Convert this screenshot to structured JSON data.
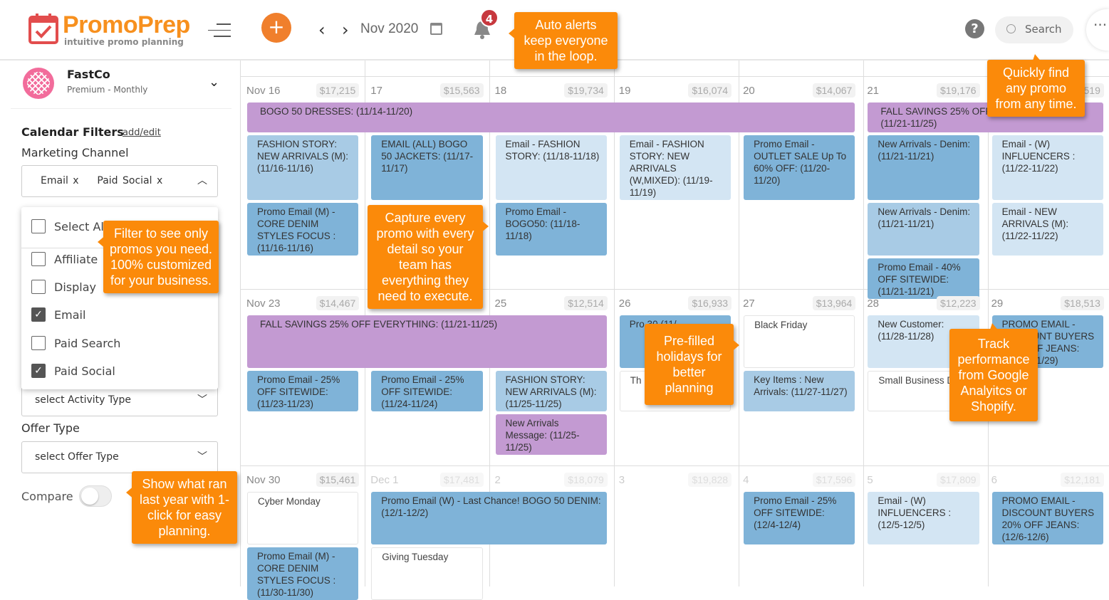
{
  "header": {
    "logo_text": "PromoPrep",
    "logo_tagline": "intuitive promo planning",
    "add_label": "+",
    "month": "Nov 2020",
    "notifications": "4",
    "help": "?",
    "search_label": "Search",
    "more": "···"
  },
  "account": {
    "name": "FastCo",
    "plan": "Premium - Monthly"
  },
  "filters": {
    "title": "Calendar Filters",
    "edit_link": "add/edit",
    "channel_label": "Marketing Channel",
    "channel_value": "Email x    Paid Social x",
    "options": [
      {
        "label": "Select All",
        "checked": false
      },
      {
        "label": "Affiliate",
        "checked": false
      },
      {
        "label": "Display",
        "checked": false
      },
      {
        "label": "Email",
        "checked": true
      },
      {
        "label": "Paid Search",
        "checked": false
      },
      {
        "label": "Paid Social",
        "checked": true
      }
    ],
    "activity_placeholder": "select Activity Type",
    "offer_label": "Offer Type",
    "offer_placeholder": "select Offer Type",
    "compare_label": "Compare",
    "compare_on": false
  },
  "colors": {
    "accent": "#f7901e",
    "dark": "#7fb3d8",
    "light": "#a8cbe5",
    "pale": "#d3e5f3",
    "purple": "#c39ad2",
    "tooltip": "#fb8a0a"
  },
  "weeks": [
    {
      "days": [
        {
          "label": "Nov 16",
          "amount": "$17,215"
        },
        {
          "label": "17",
          "amount": "$15,563"
        },
        {
          "label": "18",
          "amount": "$19,734"
        },
        {
          "label": "19",
          "amount": "$16,074"
        },
        {
          "label": "20",
          "amount": "$14,067"
        },
        {
          "label": "21",
          "amount": "$19,176"
        },
        {
          "label": "22",
          "amount": "$18,519"
        }
      ],
      "rows": [
        [
          {
            "col": 1,
            "span": 5,
            "kind": "purple",
            "text": "BOGO 50 DRESSES: (11/14-11/20)"
          },
          {
            "col": 6,
            "span": 2,
            "kind": "purple",
            "text": "FALL SAVINGS 25% OFF EVERYTHING: (11/21-11/25)"
          }
        ],
        [
          {
            "col": 1,
            "kind": "light",
            "text": "FASHION STORY: NEW ARRIVALS (M): (11/16-11/16)"
          },
          {
            "col": 2,
            "kind": "dark",
            "text": "EMAIL (ALL) BOGO 50 JACKETS: (11/17-11/17)"
          },
          {
            "col": 3,
            "kind": "pale",
            "text": "Email - FASHION STORY: (11/18-11/18)"
          },
          {
            "col": 4,
            "kind": "pale",
            "text": "Email - FASHION STORY: NEW ARRIVALS (W,MIXED): (11/19-11/19)"
          },
          {
            "col": 5,
            "kind": "dark",
            "text": "Promo Email - OUTLET SALE Up To 60% OFF: (11/20-11/20)"
          },
          {
            "col": 6,
            "kind": "dark",
            "text": "New Arrivals - Denim: (11/21-11/21)"
          },
          {
            "col": 7,
            "kind": "pale",
            "text": "Email - (W) INFLUENCERS : (11/22-11/22)"
          }
        ],
        [
          {
            "col": 1,
            "kind": "dark",
            "text": "Promo Email (M) - CORE DENIM STYLES FOCUS : (11/16-11/16)"
          },
          {
            "col": 3,
            "kind": "dark",
            "text": "Promo Email - BOGO50: (11/18-11/18)"
          },
          {
            "col": 6,
            "kind": "light",
            "text": "New Arrivals - Denim: (11/21-11/21)"
          },
          {
            "col": 7,
            "kind": "pale",
            "text": "Email - NEW ARRIVALS (M): (11/22-11/22)"
          }
        ],
        [
          {
            "col": 6,
            "kind": "dark",
            "text": "Promo Email - 40% OFF SITEWIDE: (11/21-11/21)"
          }
        ]
      ]
    },
    {
      "days": [
        {
          "label": "Nov 23",
          "amount": "$14,467"
        },
        {
          "label": "",
          "amount": ""
        },
        {
          "label": "25",
          "amount": "$12,514"
        },
        {
          "label": "26",
          "amount": "$16,933"
        },
        {
          "label": "27",
          "amount": "$13,964"
        },
        {
          "label": "28",
          "amount": "$12,223"
        },
        {
          "label": "29",
          "amount": "$18,513"
        }
      ],
      "rows": [
        [
          {
            "col": 1,
            "span": 3,
            "kind": "purple",
            "text": "FALL SAVINGS 25% OFF EVERYTHING: (11/21-11/25)"
          },
          {
            "col": 4,
            "kind": "dark",
            "text": "Pro 30 (11/"
          },
          {
            "col": 5,
            "kind": "holiday",
            "text": "Black Friday"
          },
          {
            "col": 6,
            "kind": "pale",
            "text": "New Customer: (11/28-11/28)"
          },
          {
            "col": 7,
            "kind": "dark",
            "text": "PROMO EMAIL - DISCOUNT BUYERS 20% OFF JEANS: (11/29-11/29)"
          }
        ],
        [
          {
            "col": 1,
            "kind": "dark",
            "text": "Promo Email - 25% OFF SITEWIDE: (11/23-11/23)"
          },
          {
            "col": 2,
            "kind": "dark",
            "text": "Promo Email - 25% OFF SITEWIDE: (11/24-11/24)"
          },
          {
            "col": 3,
            "kind": "light",
            "text": "FASHION STORY: NEW ARRIVALS (M): (11/25-11/25)"
          },
          {
            "col": 4,
            "kind": "holiday",
            "text": "Th"
          },
          {
            "col": 5,
            "kind": "light",
            "text": "Key Items : New Arrivals: (11/27-11/27)"
          },
          {
            "col": 6,
            "kind": "holiday",
            "text": "Small Business Day"
          }
        ],
        [
          {
            "col": 3,
            "kind": "purple",
            "text": "New Arrivals Message: (11/25-11/25)"
          }
        ]
      ]
    },
    {
      "days": [
        {
          "label": "Nov 30",
          "amount": "$15,461"
        },
        {
          "label": "Dec 1",
          "amount": "$17,481",
          "dim": true
        },
        {
          "label": "2",
          "amount": "$18,079",
          "dim": true
        },
        {
          "label": "3",
          "amount": "$19,828",
          "dim": true
        },
        {
          "label": "4",
          "amount": "$17,596",
          "dim": true
        },
        {
          "label": "5",
          "amount": "$17,809",
          "dim": true
        },
        {
          "label": "6",
          "amount": "$12,181",
          "dim": true
        }
      ],
      "rows": [
        [
          {
            "col": 1,
            "kind": "holiday",
            "text": "Cyber Monday"
          },
          {
            "col": 2,
            "span": 2,
            "kind": "dark",
            "text": "Promo Email (W) - Last Chance! BOGO 50 DENIM: (12/1-12/2)"
          },
          {
            "col": 5,
            "kind": "dark",
            "text": "Promo Email - 25% OFF SITEWIDE: (12/4-12/4)"
          },
          {
            "col": 6,
            "kind": "pale",
            "text": "Email - (W) INFLUENCERS : (12/5-12/5)"
          },
          {
            "col": 7,
            "kind": "dark",
            "text": "PROMO EMAIL - DISCOUNT BUYERS 20% OFF JEANS: (12/6-12/6)"
          }
        ],
        [
          {
            "col": 1,
            "kind": "dark",
            "text": "Promo Email (M) - CORE DENIM STYLES FOCUS : (11/30-11/30)"
          },
          {
            "col": 2,
            "kind": "holiday",
            "text": "Giving Tuesday"
          }
        ]
      ]
    }
  ],
  "tooltips": {
    "alerts": "Auto alerts keep everyone in the loop.",
    "search": "Quickly find any promo from any time.",
    "filter": "Filter to see only promos you need. 100% customized for your business.",
    "capture": "Capture every promo with every detail so your team has everything they need to execute.",
    "holidays": "Pre-filled holidays for better planning",
    "track": "Track performance from Google Analyitcs or Shopify.",
    "compare": "Show what ran last year with 1-click for easy planning."
  }
}
